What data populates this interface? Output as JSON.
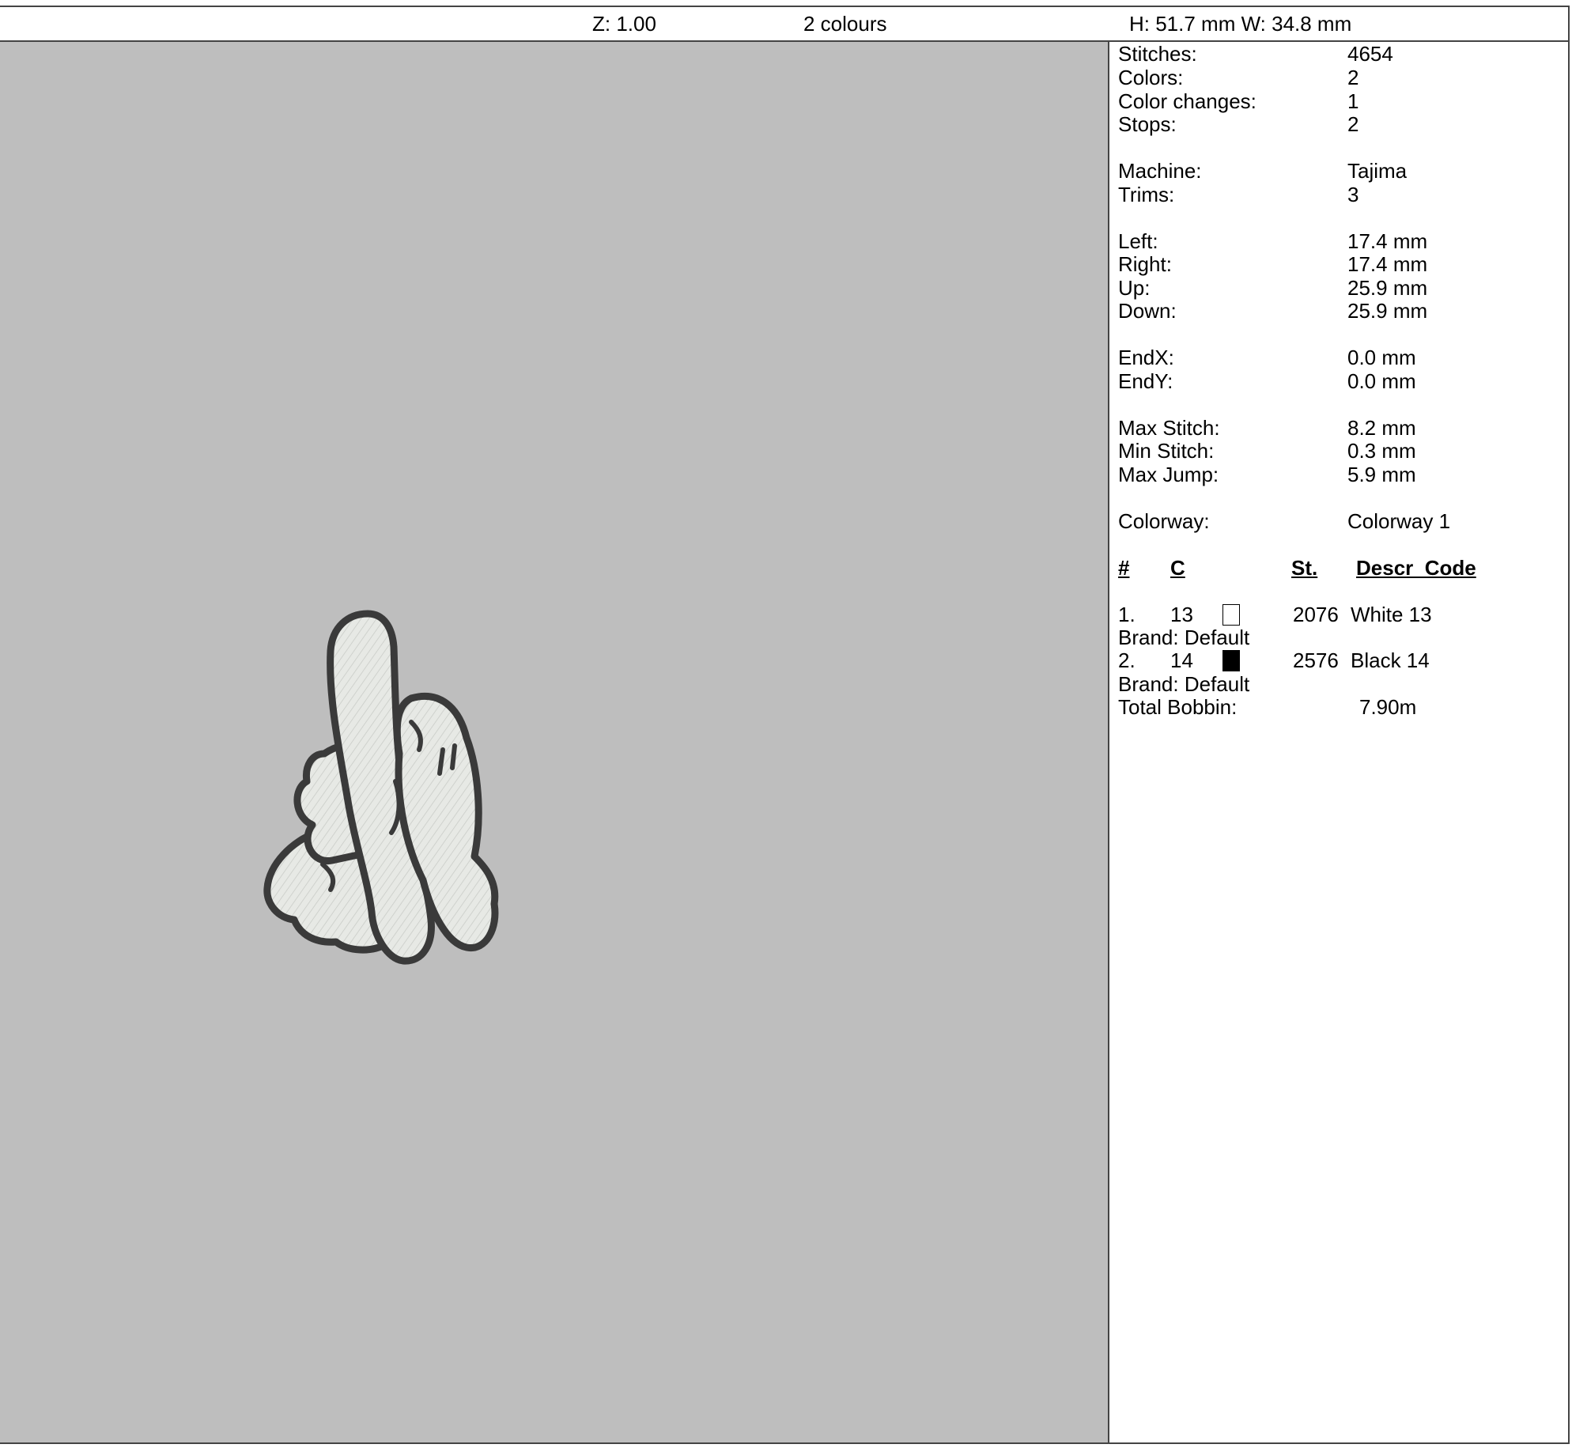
{
  "toolbar": {
    "zoom": "Z: 1.00",
    "colours": "2 colours",
    "size": "H: 51.7 mm   W: 34.8 mm"
  },
  "stats": {
    "stitches": {
      "label": "Stitches:",
      "value": "4654"
    },
    "colors": {
      "label": "Colors:",
      "value": "2"
    },
    "color_changes": {
      "label": "Color changes:",
      "value": "1"
    },
    "stops": {
      "label": "Stops:",
      "value": "2"
    },
    "machine": {
      "label": "Machine:",
      "value": "Tajima"
    },
    "trims": {
      "label": "Trims:",
      "value": "3"
    },
    "left": {
      "label": "Left:",
      "value": "17.4 mm"
    },
    "right": {
      "label": "Right:",
      "value": "17.4 mm"
    },
    "up": {
      "label": "Up:",
      "value": "25.9 mm"
    },
    "down": {
      "label": "Down:",
      "value": "25.9 mm"
    },
    "endx": {
      "label": "EndX:",
      "value": "0.0 mm"
    },
    "endy": {
      "label": "EndY:",
      "value": "0.0 mm"
    },
    "max_stitch": {
      "label": "Max Stitch:",
      "value": "8.2 mm"
    },
    "min_stitch": {
      "label": "Min Stitch:",
      "value": "0.3 mm"
    },
    "max_jump": {
      "label": "Max Jump:",
      "value": "5.9 mm"
    },
    "colorway": {
      "label": "Colorway:",
      "value": "Colorway 1"
    }
  },
  "color_table": {
    "headers": {
      "num": "#",
      "c": "C",
      "st": "St.",
      "descr": "Descr_Code"
    },
    "rows": [
      {
        "num": "1.",
        "code": "13",
        "swatch": "#ffffff",
        "stitches": "2076",
        "descr": "White 13",
        "brand": "Brand: Default"
      },
      {
        "num": "2.",
        "code": "14",
        "swatch": "#000000",
        "stitches": "2576",
        "descr": "Black 14",
        "brand": "Brand: Default"
      }
    ],
    "total_bobbin": {
      "label": "Total Bobbin:",
      "value": "7.90m"
    }
  },
  "design": {
    "fill_color": "#e6e8e4",
    "outline_color": "#3a3a3a",
    "background": "#bebebe"
  }
}
